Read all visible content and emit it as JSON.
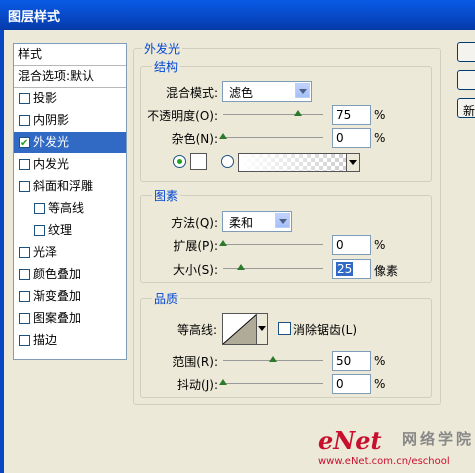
{
  "window": {
    "title": "图层样式"
  },
  "sidebar": {
    "header": "样式",
    "blend_default": "混合选项:默认",
    "items": [
      {
        "label": "投影",
        "checked": false
      },
      {
        "label": "内阴影",
        "checked": false
      },
      {
        "label": "外发光",
        "checked": true,
        "selected": true
      },
      {
        "label": "内发光",
        "checked": false
      },
      {
        "label": "斜面和浮雕",
        "checked": false
      },
      {
        "label": "等高线",
        "checked": false,
        "indent": true
      },
      {
        "label": "纹理",
        "checked": false,
        "indent": true
      },
      {
        "label": "光泽",
        "checked": false
      },
      {
        "label": "颜色叠加",
        "checked": false
      },
      {
        "label": "渐变叠加",
        "checked": false
      },
      {
        "label": "图案叠加",
        "checked": false
      },
      {
        "label": "描边",
        "checked": false
      }
    ]
  },
  "outer_glow": {
    "title": "外发光",
    "structure": {
      "title": "结构",
      "blend_mode_label": "混合模式:",
      "blend_mode_value": "滤色",
      "opacity_label": "不透明度(O):",
      "opacity_value": "75",
      "opacity_percent": 75,
      "noise_label": "杂色(N):",
      "noise_value": "0",
      "noise_percent": 0,
      "percent_unit": "%"
    },
    "elements": {
      "title": "图素",
      "method_label": "方法(Q):",
      "method_value": "柔和",
      "spread_label": "扩展(P):",
      "spread_value": "0",
      "spread_percent": 0,
      "size_label": "大小(S):",
      "size_value": "25",
      "size_unit": "像素",
      "percent_unit": "%"
    },
    "quality": {
      "title": "品质",
      "contour_label": "等高线:",
      "antialias_label": "消除锯齿(L)",
      "range_label": "范围(R):",
      "range_value": "50",
      "range_percent": 50,
      "jitter_label": "抖动(J):",
      "jitter_value": "0",
      "jitter_percent": 0,
      "percent_unit": "%"
    }
  },
  "right_buttons": {
    "new_button_partial": "新"
  },
  "watermark": {
    "brand_e": "eNet",
    "brand_cn": "网络学院",
    "url": "www.eNet.com.cn/eschool"
  },
  "colors": {
    "accent": "#0046d5",
    "selection": "#316ac5",
    "titlebar": "#0747c4"
  }
}
